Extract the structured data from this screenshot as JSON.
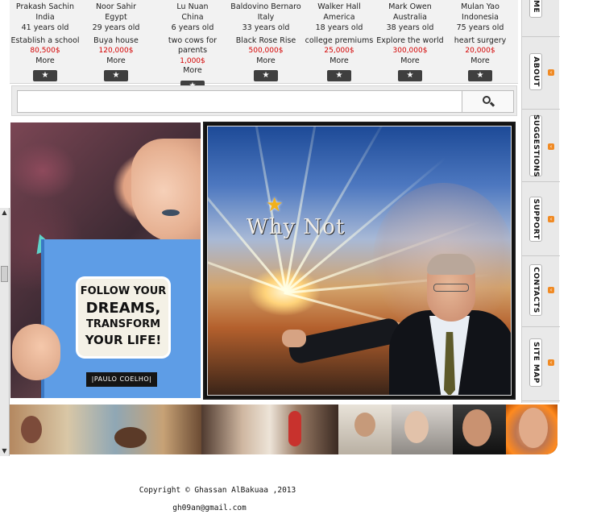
{
  "people": [
    {
      "name": "Prakash Sachin",
      "country": "India",
      "age": "41 years old",
      "goal": "Establish a school",
      "amount": "80,500$",
      "more": "More",
      "star": "★"
    },
    {
      "name": "Noor  Sahir",
      "country": "Egypt",
      "age": "29 years old",
      "goal": "Buya house",
      "amount": "120,000$",
      "more": "More",
      "star": "★"
    },
    {
      "name": "Lu  Nuan",
      "country": "China",
      "age": "6 years old",
      "goal": "two cows for parents",
      "amount": "1,000$",
      "more": "More",
      "star": "★"
    },
    {
      "name": "Baldovino  Bernaro",
      "country": "Italy",
      "age": "33 years old",
      "goal": "Black Rose Rise",
      "amount": "500,000$",
      "more": "More",
      "star": "★"
    },
    {
      "name": "Walker  Hall",
      "country": "America",
      "age": "18 years old",
      "goal": "college premiums",
      "amount": "25,000$",
      "more": "More",
      "star": "★"
    },
    {
      "name": "Mark Owen",
      "country": "Australia",
      "age": "38 years old",
      "goal": "Explore the world",
      "amount": "300,000$",
      "more": "More",
      "star": "★"
    },
    {
      "name": "Mulan Yao",
      "country": "Indonesia",
      "age": "75 years old",
      "goal": "heart surgery",
      "amount": "20,000$",
      "more": "More",
      "star": "★"
    }
  ],
  "search": {
    "placeholder": "",
    "value": ""
  },
  "nav": [
    {
      "label": "ME"
    },
    {
      "label": "ABOUT"
    },
    {
      "label": "SUGGESTIONS"
    },
    {
      "label": "SUPPORT"
    },
    {
      "label": "CONTACTS"
    },
    {
      "label": "SITE MAP"
    }
  ],
  "dream_card": {
    "line1": "FOLLOW YOUR",
    "line2": "DREAMS,",
    "line3": "TRANSFORM",
    "line4": "YOUR LIFE!",
    "author": "|PAULO COELHO|"
  },
  "whynot": {
    "text": "Why Not"
  },
  "footer": {
    "copyright": "Copyright © Ghassan AlBakuaa ,2013",
    "email": "gh09an@gmail.com"
  },
  "colors": {
    "amount": "#d40000",
    "nav_icon": "#f08a24",
    "star_button": "#3f3f3f"
  }
}
